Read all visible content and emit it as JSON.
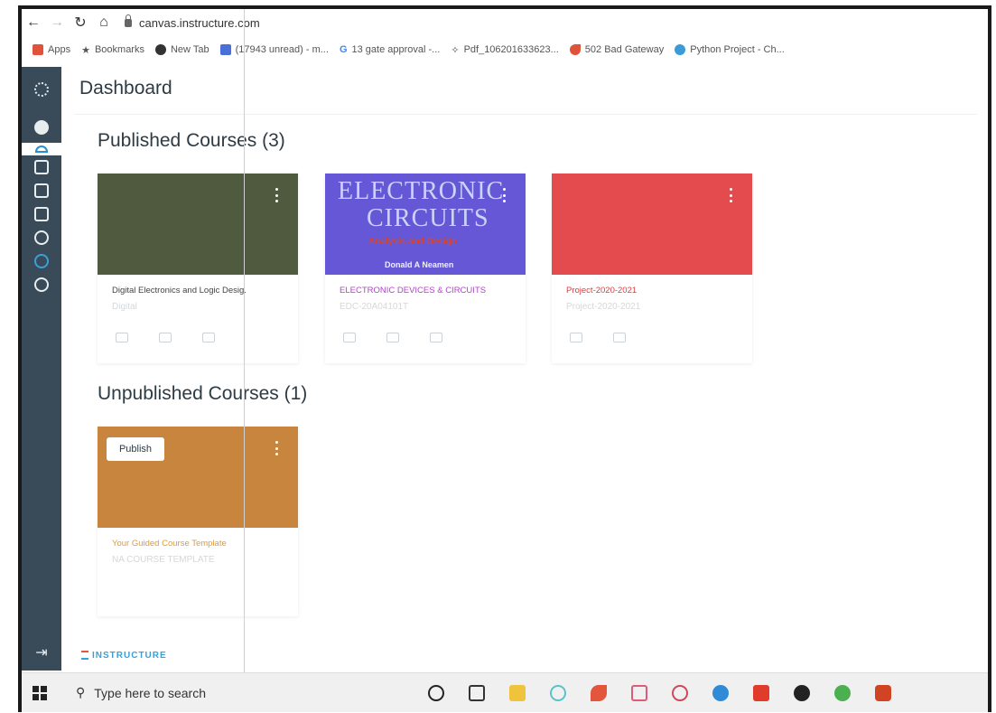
{
  "browser": {
    "url": "canvas.instructure.com",
    "bookmarks": [
      {
        "label": "Apps",
        "color": "#e0533a"
      },
      {
        "label": "Bookmarks",
        "color": "#222222"
      },
      {
        "label": "New Tab",
        "color": "#333333"
      },
      {
        "label": "(17943 unread) - m...",
        "color": "#4a6fd8"
      },
      {
        "label": "13 gate approval -...",
        "color": "#4285f4"
      },
      {
        "label": "Pdf_106201633623...",
        "color": "#333333"
      },
      {
        "label": "502 Bad Gateway",
        "color": "#e0533a"
      },
      {
        "label": "Python Project - Ch...",
        "color": "#3a9bd8"
      }
    ]
  },
  "page": {
    "title": "Dashboard",
    "published_heading": "Published Courses (3)",
    "unpublished_heading": "Unpublished Courses (1)",
    "footer_brand": "INSTRUCTURE"
  },
  "published_courses": [
    {
      "title": "Digital Electronics and Logic Desig.",
      "code": "Digital",
      "color": "#4f5a3f",
      "title_color": "#444444"
    },
    {
      "title": "ELECTRONIC DEVICES & CIRCUITS",
      "code": "EDC-20A04101T",
      "color": "#6657d6",
      "title_color": "#b044c8",
      "cover": {
        "line1": "ELECTRONIC",
        "line2": "CIRCUITS",
        "line3": "Analysis and Design",
        "line4": "Donald A Neamen"
      }
    },
    {
      "title": "Project-2020-2021",
      "code": "Project-2020-2021",
      "color": "#e34b4e",
      "title_color": "#e03c3c"
    }
  ],
  "unpublished_courses": [
    {
      "title": "Your Guided Course Template",
      "code": "NA COURSE TEMPLATE",
      "color": "#c8853e",
      "title_color": "#e09a3a",
      "publish_label": "Publish"
    }
  ],
  "taskbar": {
    "search_placeholder": "Type here to search"
  },
  "colors": {
    "sidebar": "#394b58",
    "accent": "#2a8fd0"
  }
}
